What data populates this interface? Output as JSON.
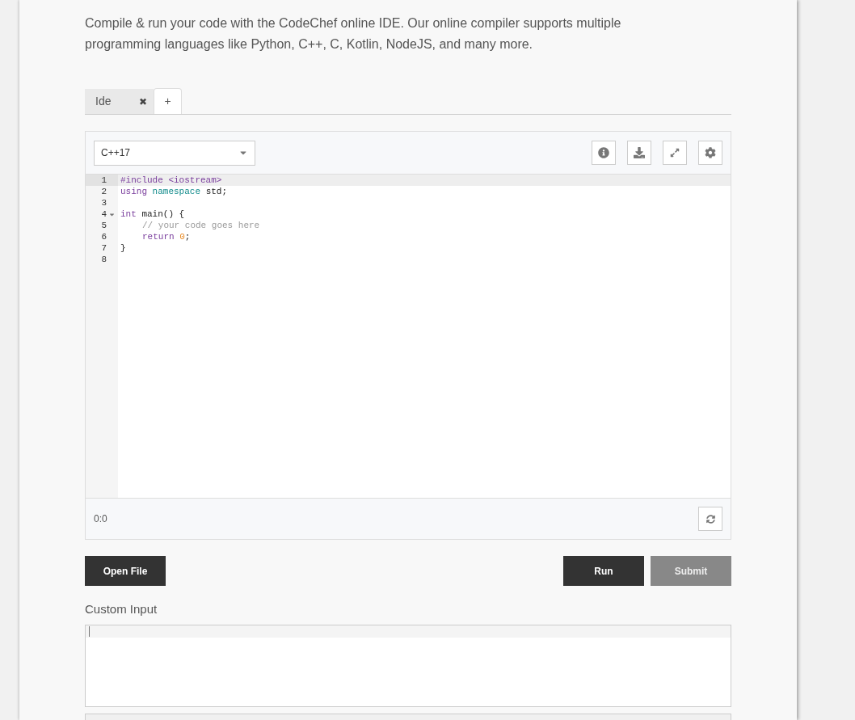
{
  "intro": "Compile & run your code with the CodeChef online IDE. Our online compiler supports multiple programming languages like Python, C++, C, Kotlin, NodeJS, and many more.",
  "tabs": [
    {
      "label": "Ide",
      "close": "✖",
      "selected": false
    },
    {
      "label": "+",
      "selected": true
    }
  ],
  "editor": {
    "language": "C++17",
    "lines": [
      {
        "number": "1",
        "active": true,
        "foldable": false,
        "tokens": [
          {
            "text": "#include <iostream>",
            "kind": "meta"
          }
        ]
      },
      {
        "number": "2",
        "active": false,
        "foldable": false,
        "tokens": [
          {
            "text": "using ",
            "kind": "keyword"
          },
          {
            "text": "namespace",
            "kind": "def"
          },
          {
            "text": " std;",
            "kind": "plain"
          }
        ]
      },
      {
        "number": "3",
        "active": false,
        "foldable": false
      },
      {
        "number": "4",
        "active": false,
        "foldable": true,
        "tokens": [
          {
            "text": "int",
            "kind": "keyword"
          },
          {
            "text": " main() {",
            "kind": "plain"
          }
        ]
      },
      {
        "number": "5",
        "active": false,
        "foldable": false,
        "indented": true,
        "tokens": [
          {
            "text": "// your code goes here",
            "kind": "comment"
          }
        ]
      },
      {
        "number": "6",
        "active": false,
        "foldable": false,
        "indented": true,
        "tokens": [
          {
            "text": "return ",
            "kind": "keyword"
          },
          {
            "text": "0",
            "kind": "number"
          },
          {
            "text": ";",
            "kind": "plain"
          }
        ]
      },
      {
        "number": "7",
        "active": false,
        "foldable": false,
        "tokens": [
          {
            "text": "}",
            "kind": "plain"
          }
        ]
      },
      {
        "number": "8",
        "active": false,
        "foldable": false
      }
    ],
    "cursor_position": "0:0"
  },
  "buttons": [
    {
      "label": "Open File",
      "kind": "dark"
    },
    {
      "label": "Run",
      "kind": "dark"
    },
    {
      "label": "Submit",
      "kind": "muted"
    }
  ],
  "custom_input": {
    "label": "Custom Input"
  }
}
